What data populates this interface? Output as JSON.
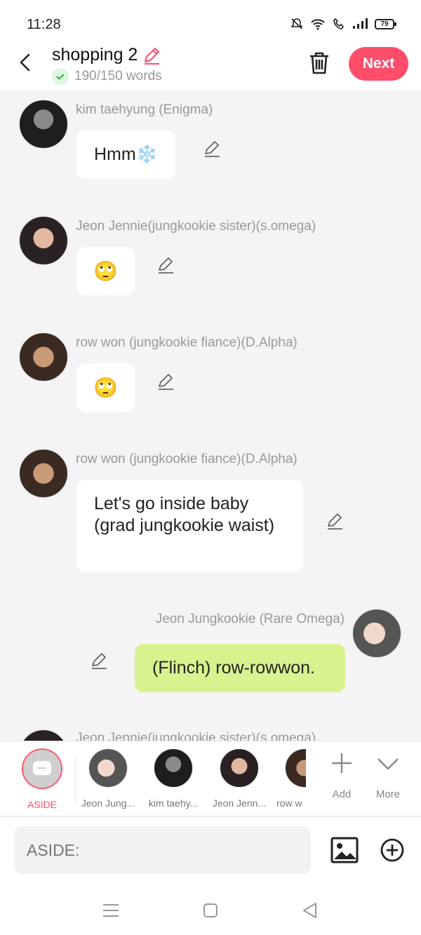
{
  "status": {
    "time": "11:28",
    "battery": "79"
  },
  "header": {
    "title": "shopping 2",
    "words": "190/150 words",
    "next_label": "Next"
  },
  "messages": [
    {
      "sender": "kim taehyung (Enigma)",
      "text": "Hmm",
      "emoji": "❄️",
      "side": "left"
    },
    {
      "sender": "Jeon Jennie(jungkookie sister)(s.omega)",
      "text": "🙄",
      "side": "left"
    },
    {
      "sender": "row won (jungkookie fiance)(D.Alpha)",
      "text": "🙄",
      "side": "left"
    },
    {
      "sender": "row won (jungkookie fiance)(D.Alpha)",
      "text": "Let's go inside baby (grad jungkookie waist)",
      "side": "left"
    },
    {
      "sender": "Jeon Jungkookie (Rare Omega)",
      "text": "(Flinch) row-rowwon.",
      "side": "right"
    },
    {
      "sender": "Jeon Jennie(jungkookie sister)(s.omega)",
      "text": "",
      "side": "left"
    }
  ],
  "characters": [
    {
      "label": "ASIDE"
    },
    {
      "label": "Jeon Jung..."
    },
    {
      "label": "kim taehy..."
    },
    {
      "label": "Jeon Jenn..."
    },
    {
      "label": "row w"
    }
  ],
  "tools": {
    "add": "Add",
    "more": "More"
  },
  "input": {
    "placeholder": "ASIDE:"
  },
  "colors": {
    "accent": "#ff4d6a",
    "self_bubble": "#d8f28f",
    "background": "#f4f4f4"
  }
}
